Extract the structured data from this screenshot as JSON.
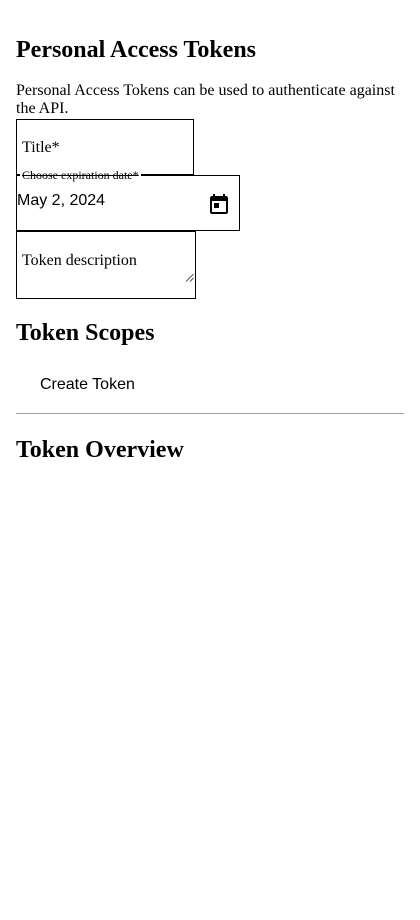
{
  "header": {
    "title": "Personal Access Tokens",
    "intro": "Personal Access Tokens can be used to authenticate against the API."
  },
  "form": {
    "title_label": "Title",
    "title_required_mark": "*",
    "expiration_label": "Choose expiration date",
    "expiration_required_mark": "*",
    "expiration_value": "May 2, 2024",
    "description_label": "Token description"
  },
  "scopes": {
    "heading": "Token Scopes",
    "create_button": "Create Token"
  },
  "overview": {
    "heading": "Token Overview"
  },
  "icons": {
    "calendar": "calendar-icon",
    "resize": "resize-grip-icon"
  }
}
